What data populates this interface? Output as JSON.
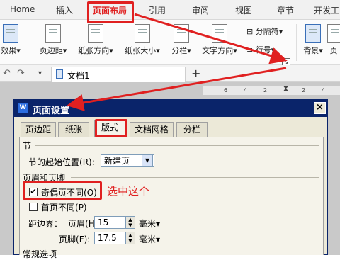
{
  "ribbon": {
    "tabs": [
      "Home",
      "插入",
      "页面布局",
      "引用",
      "审阅",
      "视图",
      "章节",
      "开发工"
    ],
    "active_tab_index": 2,
    "items": [
      "效果",
      "页边距",
      "纸张方向",
      "纸张大小",
      "分栏",
      "文字方向",
      "背景",
      "页"
    ],
    "separator_label": "分隔符",
    "lines_label": "行号",
    "undo_icon": "undo-icon",
    "redo_icon": "redo-icon"
  },
  "doc_tab": {
    "title": "文档1",
    "new_tab": "+"
  },
  "ruler": {
    "ticks": [
      "6",
      "4",
      "2",
      "",
      "2",
      "4",
      "6"
    ]
  },
  "dialog": {
    "title": "页面设置",
    "close": "×",
    "tabs": [
      "页边距",
      "纸张",
      "版式",
      "文档网格",
      "分栏"
    ],
    "selected_tab_index": 2,
    "section_label": "节",
    "section_start_label": "节的起始位置",
    "section_start_key": "(R):",
    "section_start_value": "新建页",
    "header_footer_label": "页眉和页脚",
    "odd_even_label": "奇偶页不同",
    "odd_even_key": "(O)",
    "odd_even_checked": true,
    "first_page_label": "首页不同",
    "first_page_key": "(P)",
    "first_page_checked": false,
    "distance_label": "距边界：",
    "header_label": "页眉",
    "header_key": "(H):",
    "header_value": "15",
    "footer_label": "页脚",
    "footer_key": "(F):",
    "footer_value": "17.5",
    "unit": "毫米",
    "more_label": "常规选项"
  },
  "annotation": {
    "callout": "选中这个"
  },
  "colors": {
    "highlight": "#e02020",
    "title_bar": "#0a246a"
  }
}
